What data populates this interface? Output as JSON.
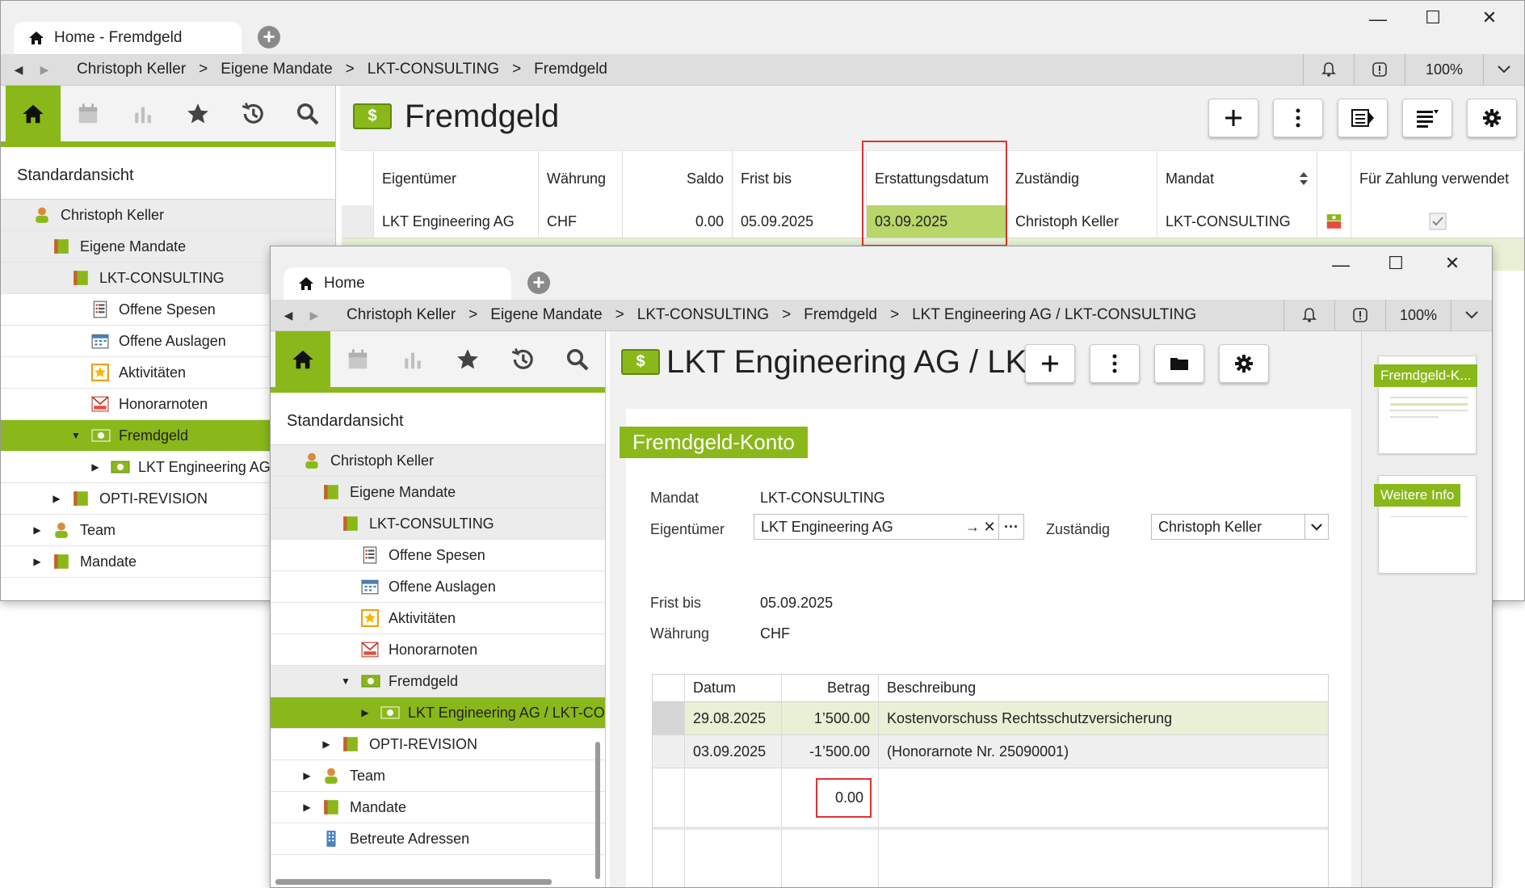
{
  "win1": {
    "tab_label": "Home - Fremdgeld",
    "breadcrumb": [
      "Christoph Keller",
      "Eigene Mandate",
      "LKT-CONSULTING",
      "Fremdgeld"
    ],
    "breadcrumb_sep": ">",
    "zoom": "100%",
    "page_title": "Fremdgeld",
    "sidebar_view": "Standardansicht",
    "tree": [
      {
        "label": "Christoph Keller",
        "icon": "person-icon"
      },
      {
        "label": "Eigene Mandate",
        "icon": "mandate-folder-icon"
      },
      {
        "label": "LKT-CONSULTING",
        "icon": "mandate-folder-icon"
      },
      {
        "label": "Offene Spesen",
        "icon": "expense-list-icon"
      },
      {
        "label": "Offene Auslagen",
        "icon": "calendar-list-icon"
      },
      {
        "label": "Aktivitäten",
        "icon": "star-box-icon"
      },
      {
        "label": "Honorarnoten",
        "icon": "invoice-icon"
      },
      {
        "label": "Fremdgeld",
        "icon": "money-icon"
      },
      {
        "label": "LKT Engineering AG",
        "icon": "money-icon"
      },
      {
        "label": "OPTI-REVISION",
        "icon": "mandate-folder-icon"
      },
      {
        "label": "Team",
        "icon": "person-icon"
      },
      {
        "label": "Mandate",
        "icon": "mandate-folder-icon"
      }
    ],
    "grid": {
      "headers": [
        "Eigentümer",
        "Währung",
        "Saldo",
        "Frist bis",
        "Erstattungsdatum",
        "Zuständig",
        "Mandat",
        "",
        "Für Zahlung verwendet"
      ],
      "row": [
        "LKT Engineering AG",
        "CHF",
        "0.00",
        "05.09.2025",
        "03.09.2025",
        "Christoph Keller",
        "LKT-CONSULTING",
        "",
        ""
      ]
    }
  },
  "win2": {
    "tab_label": "Home",
    "breadcrumb": [
      "Christoph Keller",
      "Eigene Mandate",
      "LKT-CONSULTING",
      "Fremdgeld",
      "LKT Engineering AG / LKT-CONSULTING"
    ],
    "breadcrumb_sep": ">",
    "zoom": "100%",
    "page_title": "LKT Engineering AG / LKT...",
    "sidebar_view": "Standardansicht",
    "tree": [
      {
        "label": "Christoph Keller",
        "icon": "person-icon"
      },
      {
        "label": "Eigene Mandate",
        "icon": "mandate-folder-icon"
      },
      {
        "label": "LKT-CONSULTING",
        "icon": "mandate-folder-icon"
      },
      {
        "label": "Offene Spesen",
        "icon": "expense-list-icon"
      },
      {
        "label": "Offene Auslagen",
        "icon": "calendar-list-icon"
      },
      {
        "label": "Aktivitäten",
        "icon": "star-box-icon"
      },
      {
        "label": "Honorarnoten",
        "icon": "invoice-icon"
      },
      {
        "label": "Fremdgeld",
        "icon": "money-icon"
      },
      {
        "label": "LKT Engineering AG / LKT-CO",
        "icon": "money-icon"
      },
      {
        "label": "OPTI-REVISION",
        "icon": "mandate-folder-icon"
      },
      {
        "label": "Team",
        "icon": "person-icon"
      },
      {
        "label": "Mandate",
        "icon": "mandate-folder-icon"
      },
      {
        "label": "Betreute Adressen",
        "icon": "building-icon"
      }
    ],
    "section_title": "Fremdgeld-Konto",
    "form": {
      "mandat_label": "Mandat",
      "mandat_value": "LKT-CONSULTING",
      "eigentuemer_label": "Eigentümer",
      "eigentuemer_value": "LKT Engineering AG",
      "zustaendig_label": "Zuständig",
      "zustaendig_value": "Christoph Keller",
      "frist_label": "Frist bis",
      "frist_value": "05.09.2025",
      "waehrung_label": "Währung",
      "waehrung_value": "CHF"
    },
    "subgrid": {
      "headers": [
        "Datum",
        "Betrag",
        "Beschreibung"
      ],
      "rows": [
        [
          "29.08.2025",
          "1’500.00",
          "Kostenvorschuss Rechtsschutzversicherung"
        ],
        [
          "03.09.2025",
          "-1’500.00",
          "(Honorarnote Nr. 25090001)"
        ]
      ],
      "total": "0.00"
    },
    "thumbs": [
      "Fremdgeld-K...",
      "Weitere Info"
    ]
  },
  "colors": {
    "accent": "#8ab81a",
    "highlight_border": "#e03030",
    "row_highlight": "#e8f0d6"
  }
}
